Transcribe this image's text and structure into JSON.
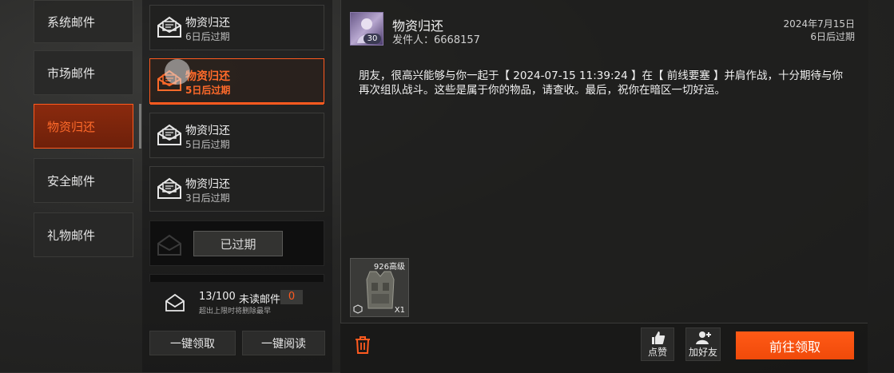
{
  "categories": [
    {
      "label": "系统邮件",
      "active": false
    },
    {
      "label": "市场邮件",
      "active": false
    },
    {
      "label": "物资归还",
      "active": true
    },
    {
      "label": "安全邮件",
      "active": false
    },
    {
      "label": "礼物邮件",
      "active": false
    }
  ],
  "mails": [
    {
      "title": "物资归还",
      "expiry": "6日后过期"
    },
    {
      "title": "物资归还",
      "expiry": "5日后过期"
    },
    {
      "title": "物资归还",
      "expiry": "5日后过期"
    },
    {
      "title": "物资归还",
      "expiry": "3日后过期"
    }
  ],
  "expired_label": "已过期",
  "mail_count": {
    "count": "13/100",
    "unread_label": "未读邮件",
    "unread_value": "0",
    "note": "超出上限时将删除最早"
  },
  "footer_left": {
    "claim_all": "一键领取",
    "read_all": "一键阅读"
  },
  "detail": {
    "title": "物资归还",
    "sender": "发件人：6668157",
    "avatar_level": "30",
    "date": "2024年7月15日",
    "expiry": "6日后过期",
    "body": "朋友，很高兴能够与你一起于【 2024-07-15 11:39:24 】在【 前线要塞 】并肩作战，十分期待与你再次组队战斗。这些是属于你的物品，请查收。最后，祝你在暗区一切好运。",
    "attachment": {
      "name": "926高级",
      "qty": "X1"
    }
  },
  "footer_right": {
    "like": "点赞",
    "add_friend": "加好友",
    "claim": "前往领取"
  },
  "colors": {
    "accent": "#ff5a1f",
    "button_orange": "#f5520f"
  }
}
